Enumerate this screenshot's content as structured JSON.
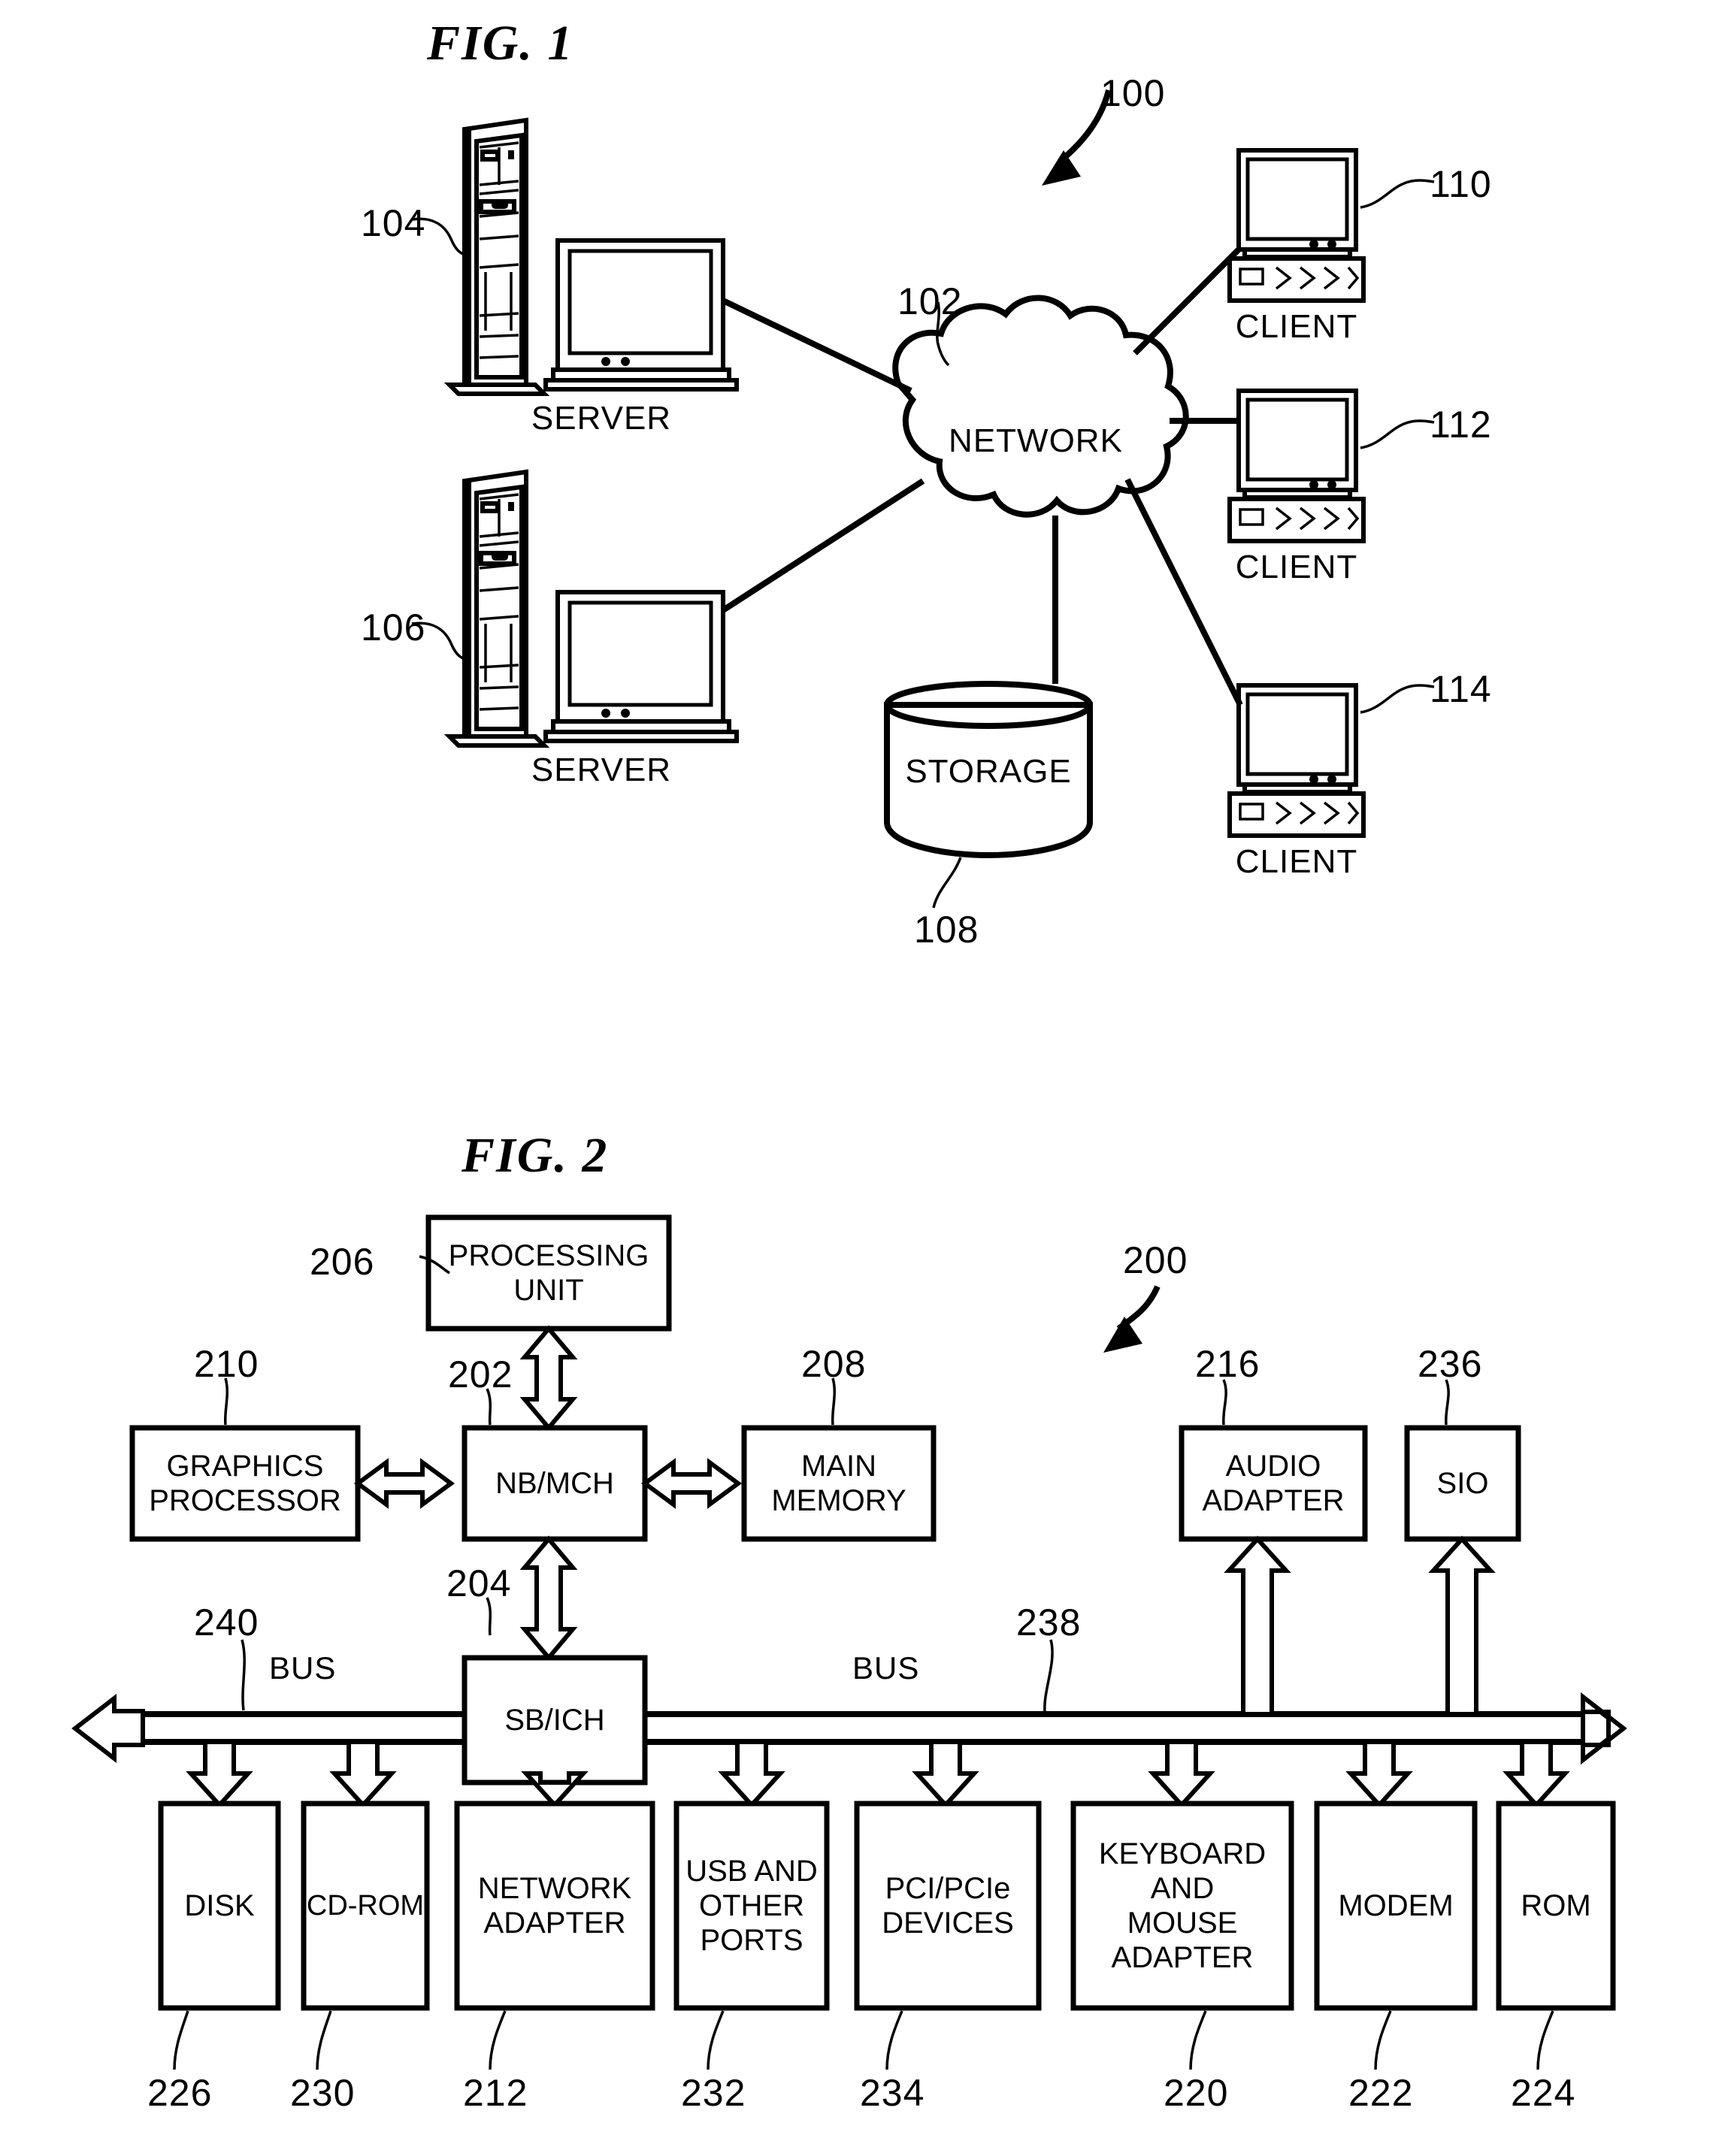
{
  "document": {
    "type": "patent-drawing-sheet",
    "figures": [
      {
        "id": "fig1",
        "title": "FIG. 1",
        "system_ref": "100",
        "nodes": [
          {
            "ref": "104",
            "label": "SERVER",
            "kind": "server-tower-monitor"
          },
          {
            "ref": "106",
            "label": "SERVER",
            "kind": "server-tower-monitor"
          },
          {
            "ref": "102",
            "label": "NETWORK",
            "kind": "cloud"
          },
          {
            "ref": "108",
            "label": "STORAGE",
            "kind": "cylinder"
          },
          {
            "ref": "110",
            "label": "CLIENT",
            "kind": "workstation"
          },
          {
            "ref": "112",
            "label": "CLIENT",
            "kind": "workstation"
          },
          {
            "ref": "114",
            "label": "CLIENT",
            "kind": "workstation"
          }
        ]
      },
      {
        "id": "fig2",
        "title": "FIG. 2",
        "system_ref": "200",
        "boxes": [
          {
            "ref": "206",
            "label": "PROCESSING\nUNIT"
          },
          {
            "ref": "210",
            "label": "GRAPHICS\nPROCESSOR"
          },
          {
            "ref": "202",
            "label": "NB/MCH"
          },
          {
            "ref": "208",
            "label": "MAIN\nMEMORY"
          },
          {
            "ref": "216",
            "label": "AUDIO\nADAPTER"
          },
          {
            "ref": "236",
            "label": "SIO"
          },
          {
            "ref": "204",
            "label": "SB/ICH"
          },
          {
            "ref": "226",
            "label": "DISK"
          },
          {
            "ref": "230",
            "label": "CD-ROM"
          },
          {
            "ref": "212",
            "label": "NETWORK\nADAPTER"
          },
          {
            "ref": "232",
            "label": "USB AND\nOTHER\nPORTS"
          },
          {
            "ref": "234",
            "label": "PCI/PCIe\nDEVICES"
          },
          {
            "ref": "220",
            "label": "KEYBOARD\nAND\nMOUSE\nADAPTER"
          },
          {
            "ref": "222",
            "label": "MODEM"
          },
          {
            "ref": "224",
            "label": "ROM"
          }
        ],
        "bus_left": {
          "ref": "240",
          "label": "BUS"
        },
        "bus_right": {
          "ref": "238",
          "label": "BUS"
        }
      }
    ]
  },
  "fig1": {
    "title": "FIG. 1",
    "ref_100": "100",
    "ref_102": "102",
    "ref_104": "104",
    "ref_106": "106",
    "ref_108": "108",
    "ref_110": "110",
    "ref_112": "112",
    "ref_114": "114",
    "network_label": "NETWORK",
    "storage_label": "STORAGE",
    "server_top_label": "SERVER",
    "server_bottom_label": "SERVER",
    "client_top_label": "CLIENT",
    "client_mid_label": "CLIENT",
    "client_bottom_label": "CLIENT"
  },
  "fig2": {
    "title": "FIG. 2",
    "ref_200": "200",
    "ref_202": "202",
    "ref_204": "204",
    "ref_206": "206",
    "ref_208": "208",
    "ref_210": "210",
    "ref_212": "212",
    "ref_216": "216",
    "ref_220": "220",
    "ref_222": "222",
    "ref_224": "224",
    "ref_226": "226",
    "ref_230": "230",
    "ref_232": "232",
    "ref_234": "234",
    "ref_236": "236",
    "ref_238": "238",
    "ref_240": "240",
    "processing_unit": "PROCESSING\nUNIT",
    "graphics_processor": "GRAPHICS\nPROCESSOR",
    "nb_mch": "NB/MCH",
    "main_memory": "MAIN\nMEMORY",
    "audio_adapter": "AUDIO\nADAPTER",
    "sio": "SIO",
    "sb_ich": "SB/ICH",
    "bus_left_label": "BUS",
    "bus_right_label": "BUS",
    "disk": "DISK",
    "cdrom": "CD-ROM",
    "network_adapter": "NETWORK\nADAPTER",
    "usb_ports": "USB AND\nOTHER\nPORTS",
    "pci_devices": "PCI/PCIe\nDEVICES",
    "keyboard_mouse": "KEYBOARD\nAND\nMOUSE\nADAPTER",
    "modem": "MODEM",
    "rom": "ROM"
  },
  "colors": {
    "ink": "#000000",
    "paper": "#ffffff"
  }
}
